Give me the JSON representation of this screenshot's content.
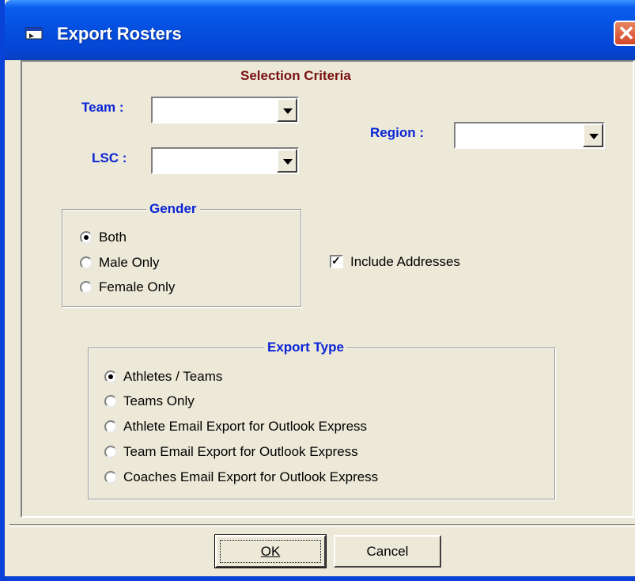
{
  "window": {
    "title": "Export Rosters"
  },
  "selection": {
    "heading": "Selection Criteria",
    "team_label": "Team :",
    "team_value": "",
    "lsc_label": "LSC :",
    "lsc_value": "",
    "region_label": "Region :",
    "region_value": ""
  },
  "gender": {
    "title": "Gender",
    "options": [
      {
        "label": "Both",
        "selected": true
      },
      {
        "label": "Male Only",
        "selected": false
      },
      {
        "label": "Female Only",
        "selected": false
      }
    ]
  },
  "include_addresses": {
    "label": "Include Addresses",
    "checked": true
  },
  "export_type": {
    "title": "Export Type",
    "options": [
      {
        "label": "Athletes / Teams",
        "selected": true
      },
      {
        "label": "Teams Only",
        "selected": false
      },
      {
        "label": "Athlete Email Export for Outlook Express",
        "selected": false
      },
      {
        "label": "Team Email Export for Outlook Express",
        "selected": false
      },
      {
        "label": "Coaches Email Export for Outlook Express",
        "selected": false
      }
    ]
  },
  "buttons": {
    "ok": "OK",
    "cancel": "Cancel"
  }
}
